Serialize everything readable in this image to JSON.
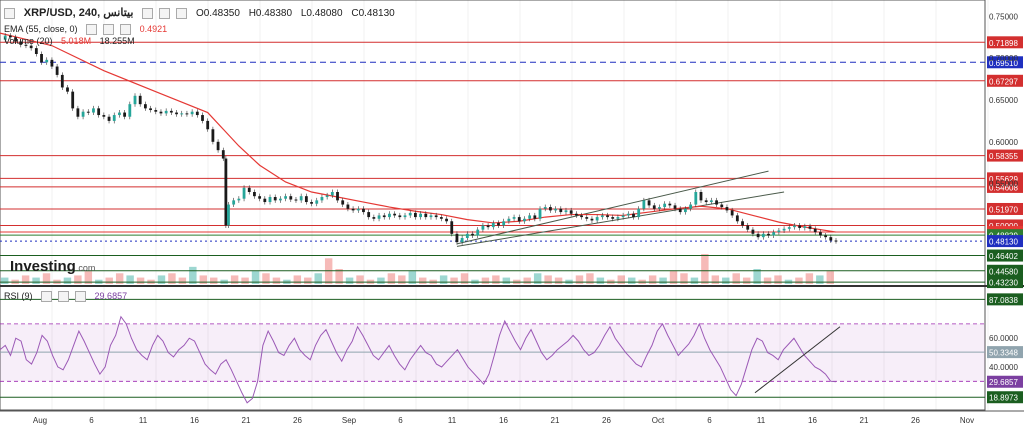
{
  "header": {
    "symbol": "XRP/USD, 240, بيتانس",
    "open": "O0.48350",
    "high": "H0.48380",
    "low": "L0.48080",
    "close": "C0.48130",
    "ema_label": "EMA (55, close, 0)",
    "ema_value": "0.4921",
    "volume_label": "Volume (20)",
    "volume_v1": "5.018M",
    "volume_v2": "18.255M",
    "rsi_label": "RSI (9)",
    "rsi_value": "29.6857"
  },
  "logo": {
    "text": "Investing",
    "suffix": ".com"
  },
  "chart_data": {
    "type": "line",
    "title": "XRP/USD, 240",
    "price_axis": {
      "ticks": [
        "0.75000",
        "0.70000",
        "0.65000",
        "0.60000",
        "0.55000"
      ],
      "range": [
        0.43,
        0.76
      ]
    },
    "price_levels": [
      {
        "label": "0.71898",
        "value": 0.71898,
        "color": "#d32f2f",
        "style": "solid"
      },
      {
        "label": "0.69510",
        "value": 0.6951,
        "color": "#1f2fbf",
        "style": "dashed"
      },
      {
        "label": "0.67297",
        "value": 0.67297,
        "color": "#d32f2f",
        "style": "solid"
      },
      {
        "label": "0.58355",
        "value": 0.58355,
        "color": "#d32f2f",
        "style": "solid"
      },
      {
        "label": "0.55629",
        "value": 0.55629,
        "color": "#d32f2f",
        "style": "solid"
      },
      {
        "label": "0.54608",
        "value": 0.54608,
        "color": "#d32f2f",
        "style": "solid"
      },
      {
        "label": "0.51970",
        "value": 0.5197,
        "color": "#d32f2f",
        "style": "solid"
      },
      {
        "label": "0.50000",
        "value": 0.5,
        "color": "#d32f2f",
        "style": "solid"
      },
      {
        "label": "0.49211",
        "value": 0.49211,
        "color": "#e53935",
        "style": "solid"
      },
      {
        "label": "0.48839",
        "value": 0.48839,
        "color": "#2e7d32",
        "style": "solid"
      },
      {
        "label": "0.48130",
        "value": 0.4813,
        "color": "#1f2fbf",
        "style": "dotted"
      },
      {
        "label": "0.46402",
        "value": 0.46402,
        "color": "#1b5e20",
        "style": "solid"
      },
      {
        "label": "0.44580",
        "value": 0.4458,
        "color": "#1b5e20",
        "style": "solid"
      },
      {
        "label": "0.43230",
        "value": 0.4323,
        "color": "#1b5e20",
        "style": "solid"
      }
    ],
    "price_series": {
      "name": "XRP/USD",
      "points": [
        [
          0,
          0.722
        ],
        [
          2,
          0.727
        ],
        [
          4,
          0.725
        ],
        [
          6,
          0.72
        ],
        [
          8,
          0.716
        ],
        [
          10,
          0.715
        ],
        [
          12,
          0.712
        ],
        [
          14,
          0.705
        ],
        [
          16,
          0.695
        ],
        [
          18,
          0.698
        ],
        [
          20,
          0.69
        ],
        [
          22,
          0.68
        ],
        [
          24,
          0.665
        ],
        [
          26,
          0.66
        ],
        [
          28,
          0.64
        ],
        [
          30,
          0.63
        ],
        [
          32,
          0.636
        ],
        [
          34,
          0.635
        ],
        [
          36,
          0.64
        ],
        [
          38,
          0.632
        ],
        [
          40,
          0.63
        ],
        [
          42,
          0.625
        ],
        [
          44,
          0.632
        ],
        [
          46,
          0.635
        ],
        [
          48,
          0.63
        ],
        [
          50,
          0.645
        ],
        [
          52,
          0.655
        ],
        [
          54,
          0.645
        ],
        [
          56,
          0.64
        ],
        [
          58,
          0.638
        ],
        [
          60,
          0.636
        ],
        [
          62,
          0.634
        ],
        [
          64,
          0.637
        ],
        [
          66,
          0.635
        ],
        [
          68,
          0.633
        ],
        [
          70,
          0.634
        ],
        [
          72,
          0.633
        ],
        [
          74,
          0.636
        ],
        [
          76,
          0.632
        ],
        [
          78,
          0.625
        ],
        [
          80,
          0.615
        ],
        [
          82,
          0.6
        ],
        [
          84,
          0.59
        ],
        [
          86,
          0.58
        ],
        [
          87,
          0.5
        ],
        [
          88,
          0.525
        ],
        [
          90,
          0.53
        ],
        [
          92,
          0.532
        ],
        [
          94,
          0.545
        ],
        [
          96,
          0.54
        ],
        [
          98,
          0.535
        ],
        [
          100,
          0.532
        ],
        [
          102,
          0.528
        ],
        [
          104,
          0.534
        ],
        [
          106,
          0.53
        ],
        [
          108,
          0.532
        ],
        [
          110,
          0.535
        ],
        [
          112,
          0.531
        ],
        [
          114,
          0.53
        ],
        [
          116,
          0.535
        ],
        [
          118,
          0.528
        ],
        [
          120,
          0.526
        ],
        [
          122,
          0.53
        ],
        [
          124,
          0.534
        ],
        [
          126,
          0.536
        ],
        [
          128,
          0.54
        ],
        [
          130,
          0.53
        ],
        [
          132,
          0.525
        ],
        [
          134,
          0.52
        ],
        [
          136,
          0.518
        ],
        [
          138,
          0.52
        ],
        [
          140,
          0.516
        ],
        [
          142,
          0.51
        ],
        [
          144,
          0.508
        ],
        [
          146,
          0.512
        ],
        [
          148,
          0.51
        ],
        [
          150,
          0.514
        ],
        [
          152,
          0.512
        ],
        [
          154,
          0.51
        ],
        [
          156,
          0.512
        ],
        [
          158,
          0.515
        ],
        [
          160,
          0.51
        ],
        [
          162,
          0.514
        ],
        [
          164,
          0.51
        ],
        [
          166,
          0.512
        ],
        [
          168,
          0.51
        ],
        [
          170,
          0.508
        ],
        [
          172,
          0.505
        ],
        [
          174,
          0.49
        ],
        [
          176,
          0.48
        ],
        [
          178,
          0.485
        ],
        [
          180,
          0.49
        ],
        [
          182,
          0.488
        ],
        [
          184,
          0.495
        ],
        [
          186,
          0.5
        ],
        [
          188,
          0.498
        ],
        [
          190,
          0.503
        ],
        [
          192,
          0.5
        ],
        [
          194,
          0.505
        ],
        [
          196,
          0.508
        ],
        [
          198,
          0.51
        ],
        [
          200,
          0.505
        ],
        [
          202,
          0.508
        ],
        [
          204,
          0.512
        ],
        [
          206,
          0.508
        ],
        [
          208,
          0.52
        ],
        [
          210,
          0.522
        ],
        [
          212,
          0.518
        ],
        [
          214,
          0.52
        ],
        [
          216,
          0.516
        ],
        [
          218,
          0.518
        ],
        [
          220,
          0.514
        ],
        [
          222,
          0.512
        ],
        [
          224,
          0.51
        ],
        [
          226,
          0.508
        ],
        [
          228,
          0.506
        ],
        [
          230,
          0.51
        ],
        [
          232,
          0.512
        ],
        [
          234,
          0.51
        ],
        [
          236,
          0.508
        ],
        [
          238,
          0.51
        ],
        [
          240,
          0.512
        ],
        [
          242,
          0.514
        ],
        [
          244,
          0.51
        ],
        [
          246,
          0.52
        ],
        [
          248,
          0.53
        ],
        [
          250,
          0.524
        ],
        [
          252,
          0.52
        ],
        [
          254,
          0.522
        ],
        [
          256,
          0.526
        ],
        [
          258,
          0.524
        ],
        [
          260,
          0.52
        ],
        [
          262,
          0.516
        ],
        [
          264,
          0.52
        ],
        [
          266,
          0.525
        ],
        [
          268,
          0.54
        ],
        [
          270,
          0.53
        ],
        [
          272,
          0.528
        ],
        [
          274,
          0.53
        ],
        [
          276,
          0.525
        ],
        [
          278,
          0.522
        ],
        [
          280,
          0.518
        ],
        [
          282,
          0.512
        ],
        [
          284,
          0.505
        ],
        [
          286,
          0.5
        ],
        [
          288,
          0.495
        ],
        [
          290,
          0.49
        ],
        [
          292,
          0.486
        ],
        [
          294,
          0.49
        ],
        [
          296,
          0.488
        ],
        [
          298,
          0.492
        ],
        [
          300,
          0.494
        ],
        [
          302,
          0.496
        ],
        [
          304,
          0.498
        ],
        [
          306,
          0.5
        ],
        [
          308,
          0.497
        ],
        [
          310,
          0.499
        ],
        [
          312,
          0.496
        ],
        [
          314,
          0.492
        ],
        [
          316,
          0.488
        ],
        [
          318,
          0.486
        ],
        [
          320,
          0.482
        ],
        [
          322,
          0.4813
        ]
      ]
    },
    "ema_series": {
      "name": "EMA (55, close, 0)",
      "points": [
        [
          0,
          0.73
        ],
        [
          20,
          0.715
        ],
        [
          40,
          0.685
        ],
        [
          60,
          0.66
        ],
        [
          80,
          0.635
        ],
        [
          86,
          0.615
        ],
        [
          92,
          0.595
        ],
        [
          100,
          0.572
        ],
        [
          110,
          0.552
        ],
        [
          120,
          0.54
        ],
        [
          130,
          0.534
        ],
        [
          140,
          0.528
        ],
        [
          150,
          0.522
        ],
        [
          160,
          0.517
        ],
        [
          170,
          0.513
        ],
        [
          180,
          0.507
        ],
        [
          190,
          0.503
        ],
        [
          200,
          0.505
        ],
        [
          210,
          0.51
        ],
        [
          220,
          0.513
        ],
        [
          230,
          0.513
        ],
        [
          240,
          0.512
        ],
        [
          250,
          0.516
        ],
        [
          260,
          0.52
        ],
        [
          270,
          0.523
        ],
        [
          280,
          0.52
        ],
        [
          290,
          0.512
        ],
        [
          300,
          0.504
        ],
        [
          310,
          0.498
        ],
        [
          322,
          0.4921
        ]
      ]
    },
    "trend_channel": [
      {
        "from": [
          176,
          0.478
        ],
        "to": [
          296,
          0.565
        ]
      },
      {
        "from": [
          176,
          0.475
        ],
        "to": [
          302,
          0.54
        ]
      }
    ],
    "volume_series": {
      "name": "Volume (20)",
      "values": [
        3,
        2,
        4,
        3,
        5,
        2,
        3,
        4,
        6,
        2,
        3,
        5,
        4,
        3,
        2,
        4,
        5,
        3,
        8,
        4,
        3,
        2,
        4,
        3,
        6,
        5,
        3,
        2,
        4,
        3,
        5,
        12,
        7,
        3,
        4,
        2,
        3,
        5,
        4,
        6,
        3,
        2,
        4,
        3,
        5,
        2,
        3,
        4,
        3,
        2,
        3,
        5,
        4,
        3,
        2,
        4,
        5,
        3,
        2,
        4,
        3,
        2,
        4,
        3,
        6,
        5,
        3,
        14,
        4,
        3,
        5,
        3,
        7,
        3,
        4,
        2,
        3,
        5,
        4,
        6
      ]
    },
    "rsi": {
      "label": "RSI (9)",
      "ticks": [
        "87.0838",
        "60.0000",
        "50.3348",
        "40.0000",
        "29.6857",
        "18.8973"
      ],
      "range": [
        10,
        95
      ],
      "levels": [
        {
          "label": "87.0838",
          "value": 87.0838,
          "color": "#1b5e20",
          "style": "solid"
        },
        {
          "label": "50.3348",
          "value": 50.3348,
          "color": "#90a4ae",
          "style": "solid"
        },
        {
          "label": "18.8973",
          "value": 18.8973,
          "color": "#1b5e20",
          "style": "solid"
        }
      ],
      "values": [
        52,
        55,
        48,
        60,
        58,
        45,
        42,
        50,
        62,
        58,
        48,
        40,
        38,
        45,
        55,
        65,
        58,
        50,
        42,
        35,
        40,
        55,
        62,
        75,
        70,
        60,
        52,
        48,
        45,
        55,
        62,
        58,
        50,
        47,
        52,
        55,
        60,
        58,
        50,
        42,
        38,
        35,
        42,
        45,
        38,
        30,
        22,
        15,
        18,
        30,
        55,
        65,
        58,
        50,
        48,
        55,
        60,
        52,
        48,
        45,
        55,
        62,
        66,
        58,
        50,
        44,
        52,
        58,
        68,
        62,
        55,
        48,
        45,
        50,
        55,
        48,
        42,
        38,
        45,
        50,
        55,
        50,
        48,
        42,
        40,
        44,
        48,
        52,
        46,
        40,
        36,
        32,
        28,
        35,
        48,
        62,
        72,
        65,
        58,
        52,
        60,
        66,
        58,
        50,
        45,
        48,
        52,
        55,
        58,
        62,
        58,
        52,
        48,
        50,
        55,
        62,
        68,
        60,
        55,
        50,
        46,
        42,
        40,
        48,
        55,
        65,
        70,
        62,
        55,
        48,
        52,
        56,
        62,
        70,
        60,
        52,
        46,
        40,
        32,
        24,
        20,
        28,
        40,
        52,
        60,
        58,
        50,
        48,
        45,
        52,
        56,
        60,
        54,
        48,
        44,
        40,
        38,
        35,
        30,
        29.7
      ]
    },
    "x_ticks": [
      "Aug",
      "6",
      "11",
      "16",
      "21",
      "26",
      "Sep",
      "6",
      "11",
      "16",
      "21",
      "26",
      "Oct",
      "6",
      "11",
      "16",
      "21",
      "26",
      "Nov"
    ]
  }
}
